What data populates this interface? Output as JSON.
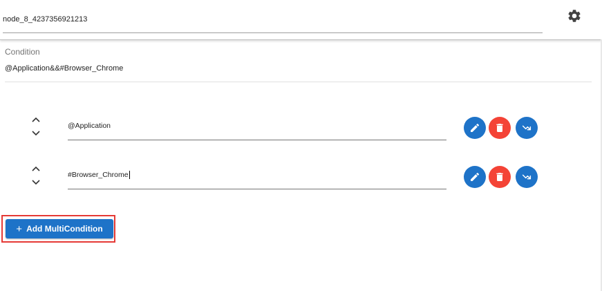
{
  "header": {
    "node_name": "node_8_4237356921213",
    "settings_icon": "gear-icon"
  },
  "condition": {
    "label": "Condition",
    "value": "@Application&&#Browser_Chrome"
  },
  "rows": [
    {
      "value": "@Application",
      "icons": [
        "chevron-up-icon",
        "chevron-down-icon",
        "pencil-icon",
        "trash-icon",
        "trend-arrow-icon"
      ]
    },
    {
      "value": "#Browser_Chrome",
      "icons": [
        "chevron-up-icon",
        "chevron-down-icon",
        "pencil-icon",
        "trash-icon",
        "trend-arrow-icon"
      ]
    }
  ],
  "add_button": {
    "plus": "+",
    "label": "Add MultiCondition"
  },
  "colors": {
    "primary": "#1e73c8",
    "danger": "#f44336",
    "highlight": "#e53935"
  }
}
